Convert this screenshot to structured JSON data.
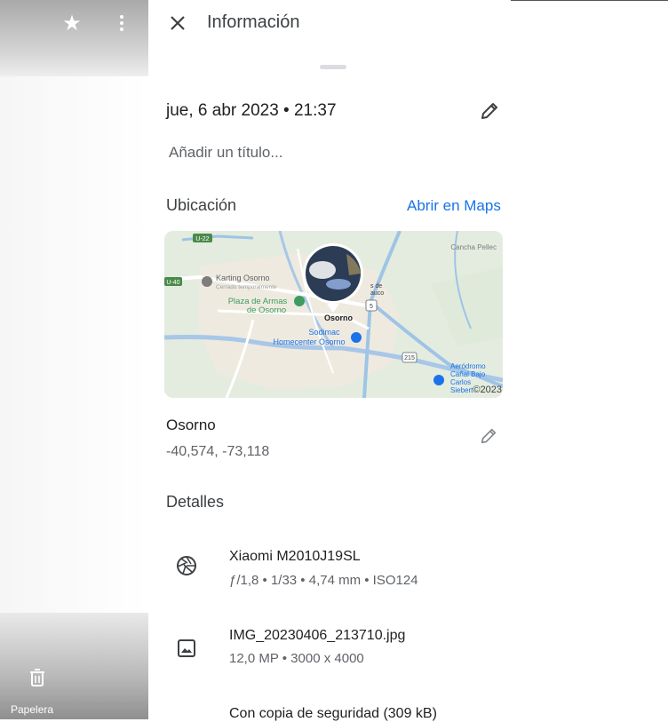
{
  "sidebar": {
    "trash_label": "Papelera"
  },
  "panel": {
    "title": "Información",
    "datetime": "jue, 6 abr 2023 • 21:37",
    "title_placeholder": "Añadir un título...",
    "location_section": "Ubicación",
    "open_maps": "Abrir en Maps",
    "place_name": "Osorno",
    "coordinates": "-40,574, -73,118",
    "details_section": "Detalles"
  },
  "map": {
    "labels": {
      "karting": "Karting Osorno",
      "karting_sub": "Cerrado temporalmente",
      "plaza1": "Plaza de Armas",
      "plaza2": "de Osorno",
      "osorno": "Osorno",
      "sodimac1": "Sodimac",
      "sodimac2": "Homecenter Osorno",
      "cancha": "Cancha Pellec",
      "aero1": "Aeródromo",
      "aero2": "Cañal Bajo",
      "aero3": "Carlos",
      "aero4": "Siebert",
      "copyright": "©2023",
      "road5": "5",
      "road215": "215",
      "road_u22": "U-22",
      "road_u40": "U-40",
      "partial": "s de",
      "partial2": "auco"
    }
  },
  "details": [
    {
      "icon": "aperture-icon",
      "title": "Xiaomi M2010J19SL",
      "subtitle": "ƒ/1,8 • 1/33 • 4,74 mm • ISO124"
    },
    {
      "icon": "image-icon",
      "title": "IMG_20230406_213710.jpg",
      "subtitle": "12,0 MP • 3000 x 4000"
    },
    {
      "icon": "backup-icon",
      "title": "Con copia de seguridad (309 kB)",
      "subtitle": ""
    }
  ],
  "colors": {
    "accent": "#1a73e8",
    "map_road": "#9ec4e6",
    "map_bg": "#e4ecdf"
  }
}
